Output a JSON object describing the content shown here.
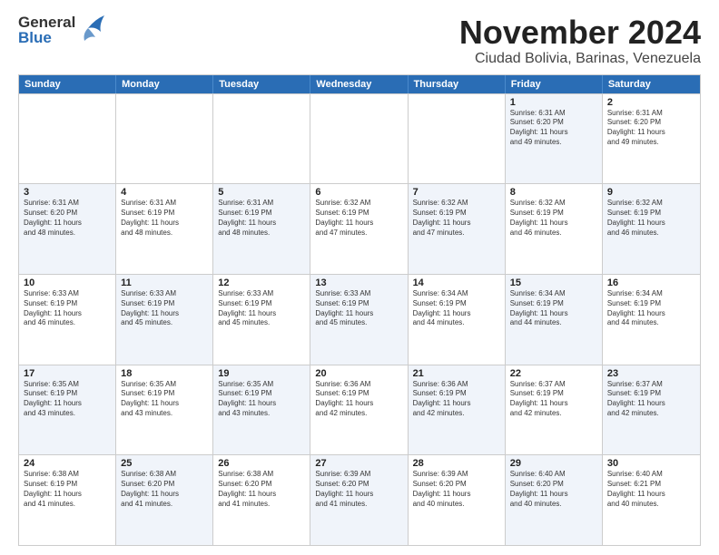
{
  "logo": {
    "line1": "General",
    "line2": "Blue"
  },
  "title": "November 2024",
  "location": "Ciudad Bolivia, Barinas, Venezuela",
  "days_of_week": [
    "Sunday",
    "Monday",
    "Tuesday",
    "Wednesday",
    "Thursday",
    "Friday",
    "Saturday"
  ],
  "weeks": [
    [
      {
        "day": "",
        "text": "",
        "shaded": false
      },
      {
        "day": "",
        "text": "",
        "shaded": false
      },
      {
        "day": "",
        "text": "",
        "shaded": false
      },
      {
        "day": "",
        "text": "",
        "shaded": false
      },
      {
        "day": "",
        "text": "",
        "shaded": false
      },
      {
        "day": "1",
        "text": "Sunrise: 6:31 AM\nSunset: 6:20 PM\nDaylight: 11 hours\nand 49 minutes.",
        "shaded": true
      },
      {
        "day": "2",
        "text": "Sunrise: 6:31 AM\nSunset: 6:20 PM\nDaylight: 11 hours\nand 49 minutes.",
        "shaded": false
      }
    ],
    [
      {
        "day": "3",
        "text": "Sunrise: 6:31 AM\nSunset: 6:20 PM\nDaylight: 11 hours\nand 48 minutes.",
        "shaded": true
      },
      {
        "day": "4",
        "text": "Sunrise: 6:31 AM\nSunset: 6:19 PM\nDaylight: 11 hours\nand 48 minutes.",
        "shaded": false
      },
      {
        "day": "5",
        "text": "Sunrise: 6:31 AM\nSunset: 6:19 PM\nDaylight: 11 hours\nand 48 minutes.",
        "shaded": true
      },
      {
        "day": "6",
        "text": "Sunrise: 6:32 AM\nSunset: 6:19 PM\nDaylight: 11 hours\nand 47 minutes.",
        "shaded": false
      },
      {
        "day": "7",
        "text": "Sunrise: 6:32 AM\nSunset: 6:19 PM\nDaylight: 11 hours\nand 47 minutes.",
        "shaded": true
      },
      {
        "day": "8",
        "text": "Sunrise: 6:32 AM\nSunset: 6:19 PM\nDaylight: 11 hours\nand 46 minutes.",
        "shaded": false
      },
      {
        "day": "9",
        "text": "Sunrise: 6:32 AM\nSunset: 6:19 PM\nDaylight: 11 hours\nand 46 minutes.",
        "shaded": true
      }
    ],
    [
      {
        "day": "10",
        "text": "Sunrise: 6:33 AM\nSunset: 6:19 PM\nDaylight: 11 hours\nand 46 minutes.",
        "shaded": false
      },
      {
        "day": "11",
        "text": "Sunrise: 6:33 AM\nSunset: 6:19 PM\nDaylight: 11 hours\nand 45 minutes.",
        "shaded": true
      },
      {
        "day": "12",
        "text": "Sunrise: 6:33 AM\nSunset: 6:19 PM\nDaylight: 11 hours\nand 45 minutes.",
        "shaded": false
      },
      {
        "day": "13",
        "text": "Sunrise: 6:33 AM\nSunset: 6:19 PM\nDaylight: 11 hours\nand 45 minutes.",
        "shaded": true
      },
      {
        "day": "14",
        "text": "Sunrise: 6:34 AM\nSunset: 6:19 PM\nDaylight: 11 hours\nand 44 minutes.",
        "shaded": false
      },
      {
        "day": "15",
        "text": "Sunrise: 6:34 AM\nSunset: 6:19 PM\nDaylight: 11 hours\nand 44 minutes.",
        "shaded": true
      },
      {
        "day": "16",
        "text": "Sunrise: 6:34 AM\nSunset: 6:19 PM\nDaylight: 11 hours\nand 44 minutes.",
        "shaded": false
      }
    ],
    [
      {
        "day": "17",
        "text": "Sunrise: 6:35 AM\nSunset: 6:19 PM\nDaylight: 11 hours\nand 43 minutes.",
        "shaded": true
      },
      {
        "day": "18",
        "text": "Sunrise: 6:35 AM\nSunset: 6:19 PM\nDaylight: 11 hours\nand 43 minutes.",
        "shaded": false
      },
      {
        "day": "19",
        "text": "Sunrise: 6:35 AM\nSunset: 6:19 PM\nDaylight: 11 hours\nand 43 minutes.",
        "shaded": true
      },
      {
        "day": "20",
        "text": "Sunrise: 6:36 AM\nSunset: 6:19 PM\nDaylight: 11 hours\nand 42 minutes.",
        "shaded": false
      },
      {
        "day": "21",
        "text": "Sunrise: 6:36 AM\nSunset: 6:19 PM\nDaylight: 11 hours\nand 42 minutes.",
        "shaded": true
      },
      {
        "day": "22",
        "text": "Sunrise: 6:37 AM\nSunset: 6:19 PM\nDaylight: 11 hours\nand 42 minutes.",
        "shaded": false
      },
      {
        "day": "23",
        "text": "Sunrise: 6:37 AM\nSunset: 6:19 PM\nDaylight: 11 hours\nand 42 minutes.",
        "shaded": true
      }
    ],
    [
      {
        "day": "24",
        "text": "Sunrise: 6:38 AM\nSunset: 6:19 PM\nDaylight: 11 hours\nand 41 minutes.",
        "shaded": false
      },
      {
        "day": "25",
        "text": "Sunrise: 6:38 AM\nSunset: 6:20 PM\nDaylight: 11 hours\nand 41 minutes.",
        "shaded": true
      },
      {
        "day": "26",
        "text": "Sunrise: 6:38 AM\nSunset: 6:20 PM\nDaylight: 11 hours\nand 41 minutes.",
        "shaded": false
      },
      {
        "day": "27",
        "text": "Sunrise: 6:39 AM\nSunset: 6:20 PM\nDaylight: 11 hours\nand 41 minutes.",
        "shaded": true
      },
      {
        "day": "28",
        "text": "Sunrise: 6:39 AM\nSunset: 6:20 PM\nDaylight: 11 hours\nand 40 minutes.",
        "shaded": false
      },
      {
        "day": "29",
        "text": "Sunrise: 6:40 AM\nSunset: 6:20 PM\nDaylight: 11 hours\nand 40 minutes.",
        "shaded": true
      },
      {
        "day": "30",
        "text": "Sunrise: 6:40 AM\nSunset: 6:21 PM\nDaylight: 11 hours\nand 40 minutes.",
        "shaded": false
      }
    ]
  ]
}
